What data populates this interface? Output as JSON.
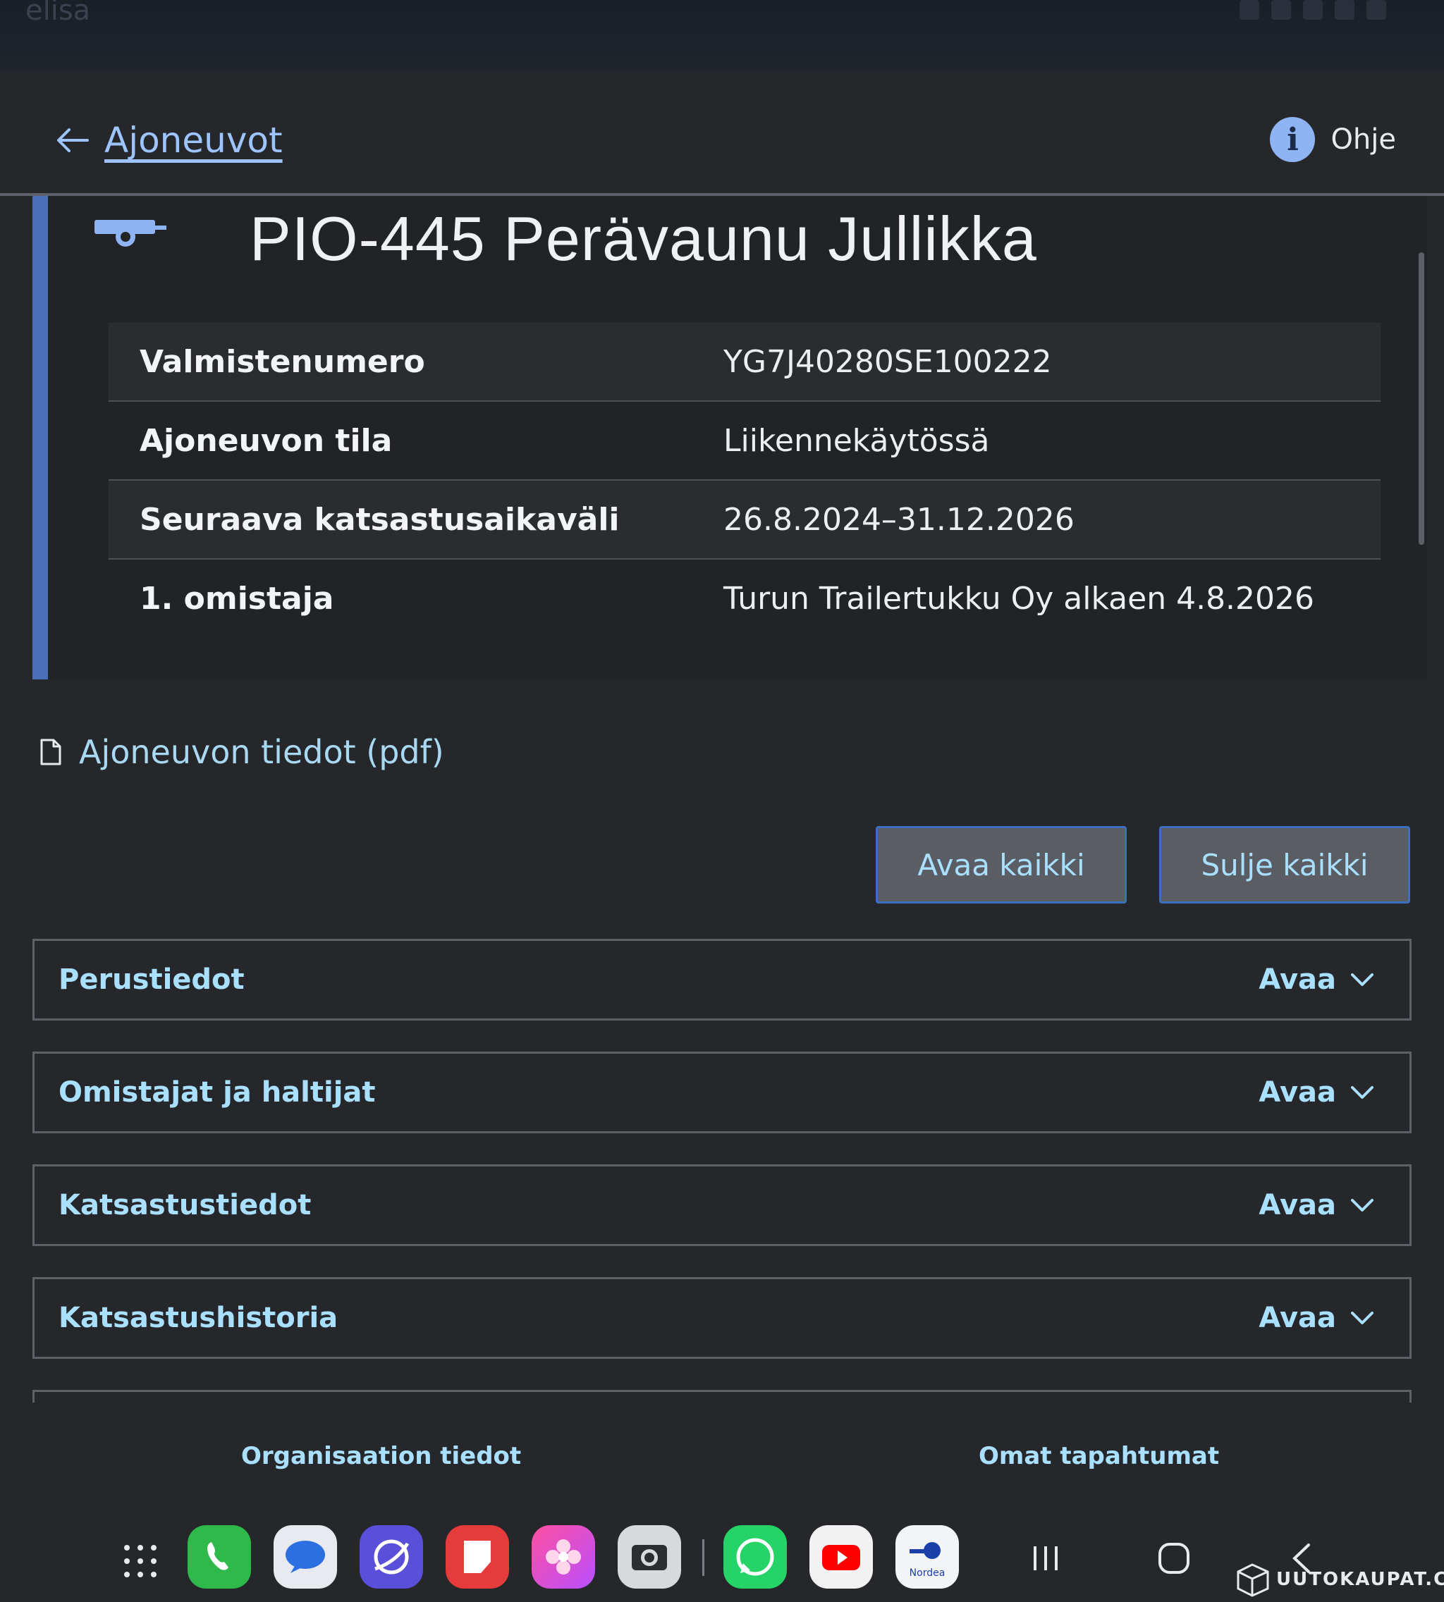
{
  "statusbar": {
    "carrier": "elisa"
  },
  "header": {
    "back_label": "Ajoneuvot",
    "help_label": "Ohje"
  },
  "vehicle": {
    "title": "PIO-445 Perävaunu Jullikka",
    "rows": [
      {
        "label": "Valmistenumero",
        "value": "YG7J40280SE100222"
      },
      {
        "label": "Ajoneuvon tila",
        "value": "Liikennekäytössä"
      },
      {
        "label": "Seuraava katsastusaikaväli",
        "value": "26.8.2024–31.12.2026"
      },
      {
        "label": "1. omistaja",
        "value": "Turun Trailertukku Oy alkaen 4.8.2026"
      }
    ]
  },
  "pdf_link": {
    "label": "Ajoneuvon tiedot (pdf)"
  },
  "buttons": {
    "open_all": "Avaa kaikki",
    "close_all": "Sulje kaikki"
  },
  "accordions": [
    {
      "title": "Perustiedot",
      "toggle": "Avaa"
    },
    {
      "title": "Omistajat ja haltijat",
      "toggle": "Avaa"
    },
    {
      "title": "Katsastustiedot",
      "toggle": "Avaa"
    },
    {
      "title": "Katsastushistoria",
      "toggle": "Avaa"
    }
  ],
  "bottom_nav": {
    "org": "Organisaation tiedot",
    "own": "Omat tapahtumat"
  },
  "dock": {
    "apps": [
      "phone-icon",
      "messages-icon",
      "browser-icon",
      "notes-icon",
      "gallery-icon",
      "camera-icon",
      "whatsapp-icon",
      "youtube-icon",
      "nordea-icon"
    ],
    "nordea_label": "Nordea"
  },
  "watermark": {
    "text": "UUTOKAUPAT.COM"
  },
  "colors": {
    "accent": "#4a6fb8",
    "link": "#9dc4ff",
    "accordion_text": "#a9e0ff",
    "background": "#25272b"
  }
}
